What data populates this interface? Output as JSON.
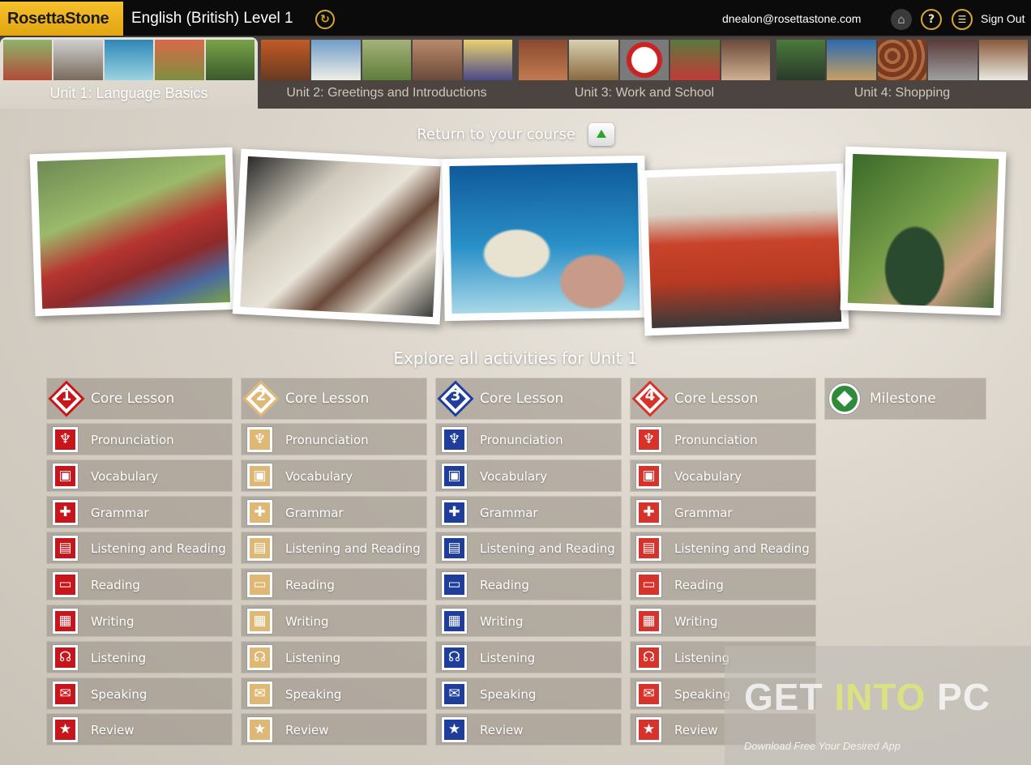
{
  "app": {
    "brand": "RosettaStone",
    "course_title": "English (British) Level 1",
    "user_email": "dnealon@rosettastone.com",
    "sign_out": "Sign Out"
  },
  "icons": {
    "refresh": "refresh-icon",
    "home": "home-icon",
    "help": "help-icon",
    "menu": "menu-list-icon"
  },
  "units": [
    {
      "label": "Unit 1: Language Basics",
      "active": true
    },
    {
      "label": "Unit 2: Greetings and Introductions",
      "active": false
    },
    {
      "label": "Unit 3: Work and School",
      "active": false
    },
    {
      "label": "Unit 4: Shopping",
      "active": false
    }
  ],
  "return_label": "Return to your course",
  "explore_label": "Explore all activities for Unit 1",
  "lessons": [
    {
      "number": "1",
      "title": "Core Lesson",
      "color": "#c8141b"
    },
    {
      "number": "2",
      "title": "Core Lesson",
      "color": "#e0b876"
    },
    {
      "number": "3",
      "title": "Core Lesson",
      "color": "#1f3e9c"
    },
    {
      "number": "4",
      "title": "Core Lesson",
      "color": "#d8332b"
    }
  ],
  "activities": [
    "Pronunciation",
    "Vocabulary",
    "Grammar",
    "Listening and Reading",
    "Reading",
    "Writing",
    "Listening",
    "Speaking",
    "Review"
  ],
  "milestone": "Milestone",
  "watermark": {
    "part1": "GET ",
    "part2": "INTO",
    "part3": " PC",
    "tagline": "Download Free Your Desired App"
  }
}
